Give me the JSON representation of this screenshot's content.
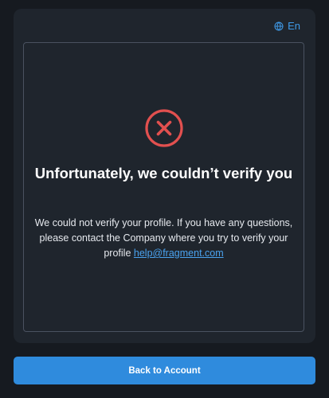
{
  "language": {
    "label": "En",
    "icon": "globe-icon"
  },
  "status": {
    "icon": "error-x-circle-icon",
    "title": "Unfortunately, we couldn’t verify you",
    "message": "We could not verify your profile. If you have any questions, please contact the Company where you try to verify your profile",
    "email": "help@fragment.com"
  },
  "actions": {
    "back_label": "Back to Account"
  },
  "colors": {
    "background": "#161a20",
    "card": "#1f252d",
    "accent": "#2f8bdd",
    "error": "#e2504f",
    "link": "#4aa3f0"
  }
}
